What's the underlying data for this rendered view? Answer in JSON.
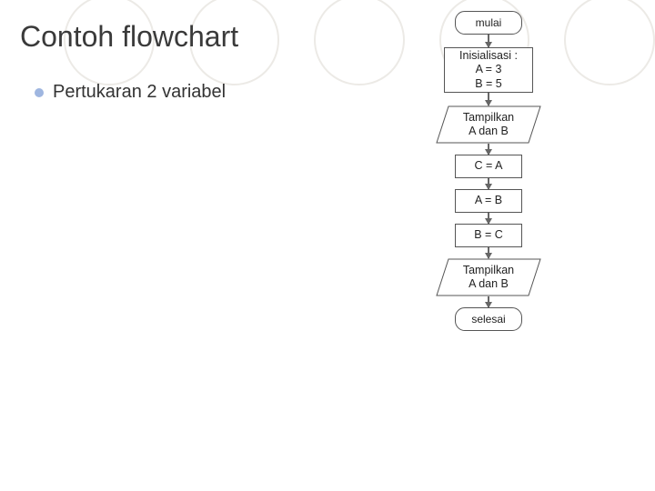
{
  "title": "Contoh flowchart",
  "bullet": "Pertukaran 2 variabel",
  "flow": {
    "start": "mulai",
    "init_l1": "Inisialisasi :",
    "init_l2": "A = 3",
    "init_l3": "B = 5",
    "io1_l1": "Tampilkan",
    "io1_l2": "A dan B",
    "p1": "C = A",
    "p2": "A = B",
    "p3": "B = C",
    "io2_l1": "Tampilkan",
    "io2_l2": "A dan B",
    "end": "selesai"
  }
}
